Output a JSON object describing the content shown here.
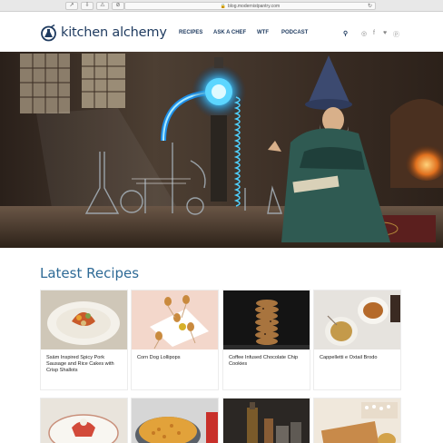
{
  "browser": {
    "url": "blog.modernistpantry.com",
    "lock_glyph": "🔒",
    "reload_glyph": "↻",
    "toolbar_glyphs": [
      "↗",
      "⇩",
      "⚠",
      "⊘"
    ]
  },
  "header": {
    "logo_text": "kitchen alchemy",
    "nav": [
      {
        "label": "RECIPES"
      },
      {
        "label": "ASK A CHEF"
      },
      {
        "label": "WTF"
      },
      {
        "label": "PODCAST"
      }
    ],
    "icons": {
      "search": "⚲",
      "instagram": "◎",
      "facebook": "f",
      "twitter": "♥",
      "pinterest": "ⓟ"
    }
  },
  "main": {
    "section_title": "Latest Recipes",
    "recipes_row1": [
      {
        "title": "Ssäm Inspired Spicy Pork Sausage and Rice Cakes with Crisp Shallots"
      },
      {
        "title": "Corn Dog Lollipops"
      },
      {
        "title": "Coffee Infused Chocolate Chip Cookies"
      },
      {
        "title": "Cappelletti e Oxtail Brodo"
      }
    ]
  },
  "colors": {
    "brand_navy": "#1e3a5f",
    "heading_blue": "#2e6a96"
  }
}
